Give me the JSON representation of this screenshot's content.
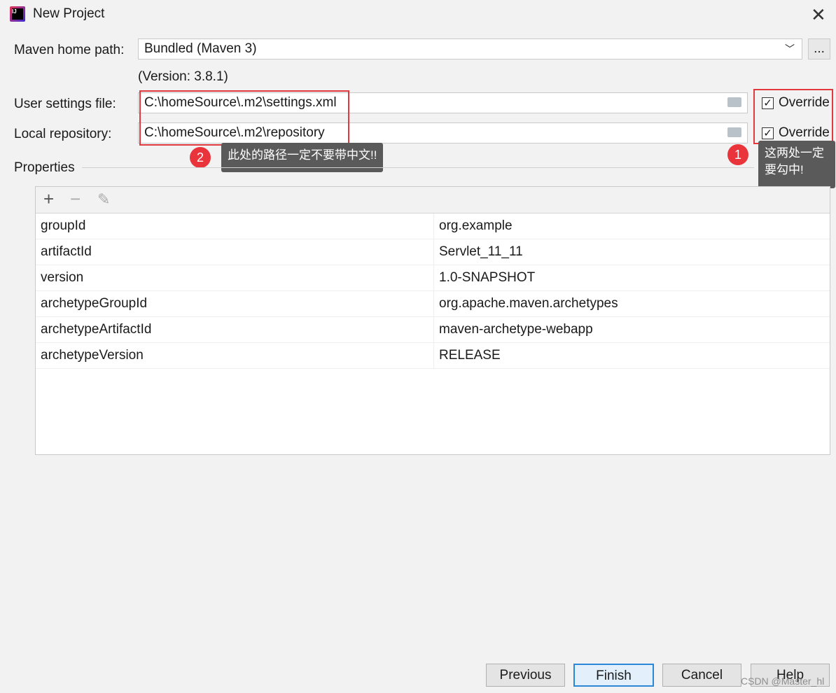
{
  "window": {
    "title": "New Project",
    "icon": "intellij-icon"
  },
  "maven_home": {
    "label": "Maven home path:",
    "value": "Bundled (Maven 3)",
    "version": "(Version: 3.8.1)",
    "browse": "..."
  },
  "user_settings": {
    "label": "User settings file:",
    "value": "C:\\homeSource\\.m2\\settings.xml",
    "override": "Override",
    "checked": true
  },
  "local_repo": {
    "label": "Local repository:",
    "value": "C:\\homeSource\\.m2\\repository",
    "override": "Override",
    "checked": true
  },
  "annotations": {
    "badge1": "1",
    "tip1": "这两处一定要勾中!",
    "badge2": "2",
    "tip2": "此处的路径一定不要带中文!!"
  },
  "properties": {
    "title": "Properties",
    "rows": [
      [
        "groupId",
        "org.example"
      ],
      [
        "artifactId",
        "Servlet_11_11"
      ],
      [
        "version",
        "1.0-SNAPSHOT"
      ],
      [
        "archetypeGroupId",
        "org.apache.maven.archetypes"
      ],
      [
        "archetypeArtifactId",
        "maven-archetype-webapp"
      ],
      [
        "archetypeVersion",
        "RELEASE"
      ]
    ]
  },
  "buttons": {
    "previous": "Previous",
    "finish": "Finish",
    "cancel": "Cancel",
    "help": "Help"
  },
  "watermark": "CSDN @Master_hl"
}
